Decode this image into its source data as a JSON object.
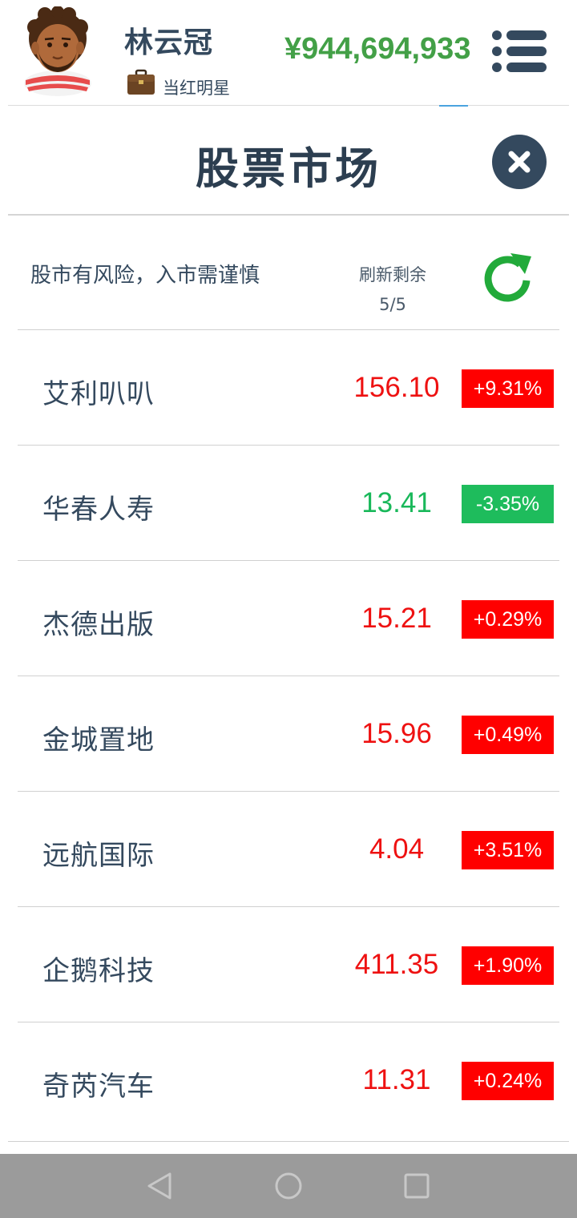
{
  "header": {
    "player_name": "林云冠",
    "job_title": "当红明星",
    "money": "¥944,694,933"
  },
  "panel": {
    "title": "股票市场",
    "warning": "股市有风险，入市需谨慎",
    "refresh_label": "刷新剩余",
    "refresh_count": "5/5"
  },
  "colors": {
    "up": "#ee1111",
    "down": "#19b85a",
    "up_badge": "#ff0000",
    "down_badge": "#1ebc5c",
    "money": "#43a047",
    "refresh_icon": "#22aa3a",
    "dark": "#34495e"
  },
  "stocks": [
    {
      "name": "艾利叭叭",
      "price": "156.10",
      "change": "+9.31%",
      "trend": "up"
    },
    {
      "name": "华春人寿",
      "price": "13.41",
      "change": "-3.35%",
      "trend": "down"
    },
    {
      "name": "杰德出版",
      "price": "15.21",
      "change": "+0.29%",
      "trend": "up"
    },
    {
      "name": "金城置地",
      "price": "15.96",
      "change": "+0.49%",
      "trend": "up"
    },
    {
      "name": "远航国际",
      "price": "4.04",
      "change": "+3.51%",
      "trend": "up"
    },
    {
      "name": "企鹅科技",
      "price": "411.35",
      "change": "+1.90%",
      "trend": "up"
    },
    {
      "name": "奇芮汽车",
      "price": "11.31",
      "change": "+0.24%",
      "trend": "up"
    }
  ],
  "icons": {
    "avatar": "player-avatar",
    "job": "briefcase-icon",
    "menu": "menu-icon",
    "close": "close-icon",
    "refresh": "refresh-icon",
    "nav_back": "back-icon",
    "nav_home": "home-icon",
    "nav_recent": "recent-apps-icon"
  }
}
